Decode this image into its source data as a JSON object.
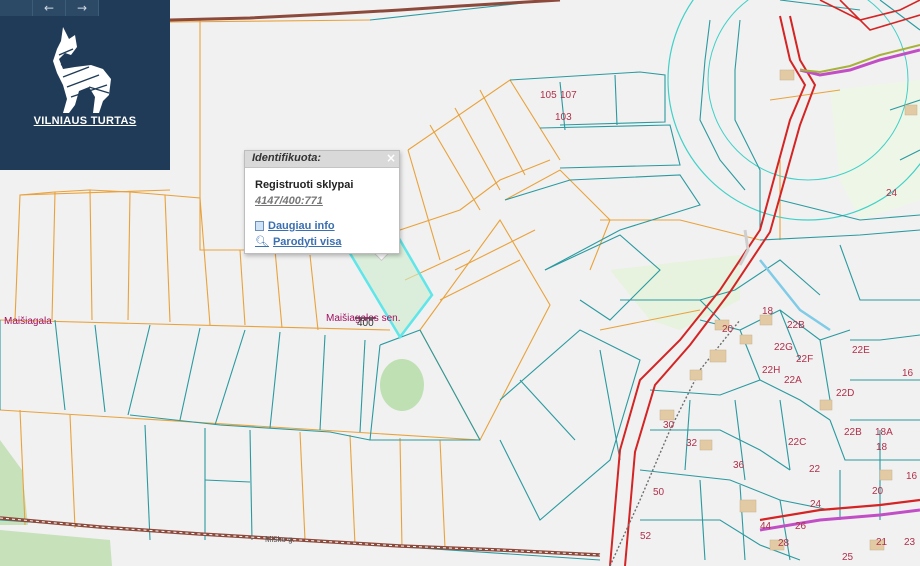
{
  "header": {
    "logo_text": "VILNIAUS TURTAS",
    "logo_icon": "wolf-logo-icon",
    "nav_back": "←",
    "nav_forward": "→"
  },
  "popup": {
    "title": "Identifikuota:",
    "close": "×",
    "layer_name": "Registruoti sklypai",
    "parcel_id": "4147/400:771",
    "more_info": "Daugiau info",
    "show_all": "Parodyti visa"
  },
  "places": {
    "maisiagala": "Maišiagala",
    "maisiagalos_sen": "Maišiagalos sen.",
    "road_label": "Miško g."
  },
  "parcel_numbers": [
    "105",
    "107",
    "103",
    "400",
    "24",
    "18",
    "20",
    "22E",
    "22B",
    "22G",
    "22F",
    "22H",
    "22D",
    "16",
    "22A",
    "22C",
    "22",
    "30",
    "32",
    "36",
    "50",
    "52",
    "44",
    "26",
    "28",
    "22B",
    "18A",
    "18",
    "16",
    "20",
    "24",
    "25",
    "21",
    "23"
  ],
  "colors": {
    "parcel_teal": "#2a9aa0",
    "parcel_orange": "#e9a23b",
    "road_red": "#d42424",
    "highlight_cyan": "#5fe6ea",
    "green_area": "#b9dcae",
    "panel_navy": "#1f3b57"
  }
}
